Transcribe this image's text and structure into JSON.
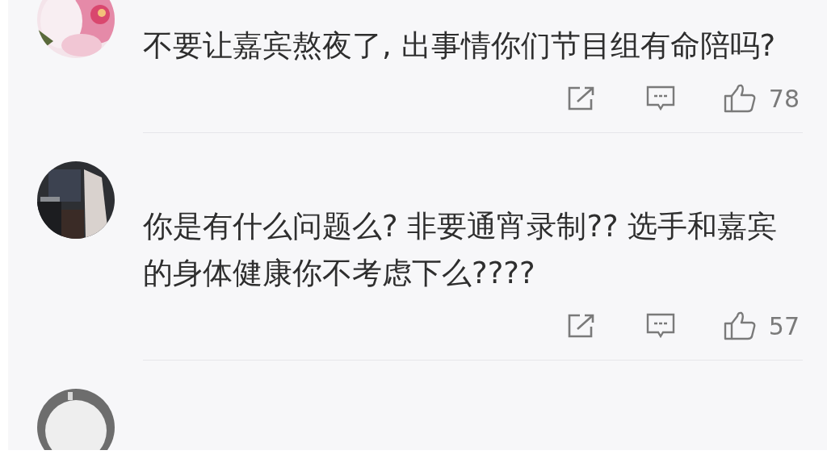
{
  "comments": [
    {
      "avatar": {
        "kind": "picture"
      },
      "text": "不要让嘉宾熬夜了, 出事情你们节目组有命陪吗?",
      "likes": "78"
    },
    {
      "avatar": {
        "kind": "picture"
      },
      "text": "你是有什么问题么? 非要通宵录制?? 选手和嘉宾的身体健康你不考虑下么????",
      "likes": "57"
    },
    {
      "avatar": {
        "kind": "picture"
      }
    }
  ]
}
